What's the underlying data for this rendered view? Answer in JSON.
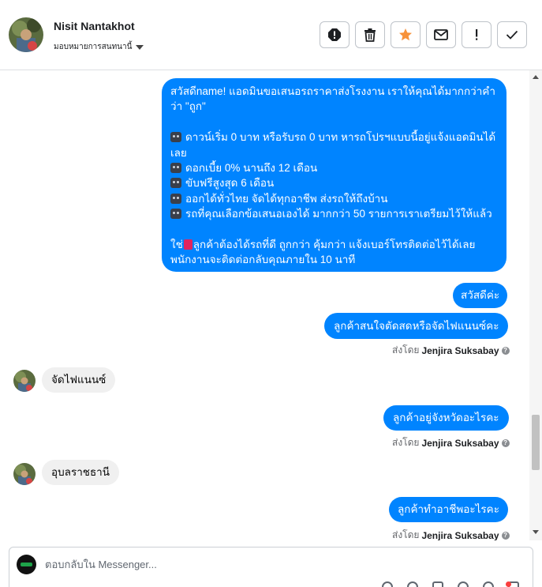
{
  "header": {
    "contact_name": "Nisit Nantakhot",
    "assign_label": "มอบหมายการสนทนานี้",
    "actions": [
      {
        "name": "spam-button",
        "icon": "alert-octagon-icon"
      },
      {
        "name": "delete-button",
        "icon": "trash-icon"
      },
      {
        "name": "star-button",
        "icon": "star-icon"
      },
      {
        "name": "mark-unread-button",
        "icon": "envelope-icon"
      },
      {
        "name": "follow-up-button",
        "icon": "exclamation-icon"
      },
      {
        "name": "mark-done-button",
        "icon": "check-icon"
      }
    ]
  },
  "thread": {
    "big_message": {
      "line1": "สวัสดีname! แอดมินขอเสนอรถราคาส่งโรงงาน เราให้คุณได้มากกว่าคำ",
      "line2": "ว่า \"ถูก\"",
      "line3": "ดาวน์เริ่ม 0 บาท หรือรับรถ 0 บาท หารถโปรฯแบบนี้อยู่แจ้งแอดมินได้",
      "line4": "เลย",
      "line5": "ดอกเบี้ย 0% นานถึง 12 เดือน",
      "line6": "ขับฟรีสูงสุด 6 เดือน",
      "line7": "ออกได้ทั่วไทย จัดได้ทุกอาชีพ ส่งรถให้ถึงบ้าน",
      "line8": "รถที่คุณเลือกข้อเสนอเองได้ มากกว่า 50 รายการเราเตรียมไว้ให้แล้ว",
      "line9a": "ใช่",
      "line9b": "ลูกค้าต้องได้รถที่ดี ถูกกว่า คุ้มกว่า แจ้งเบอร์โทรติดต่อไว้ได้เลย",
      "line10": "พนักงานจะติดต่อกลับคุณภายใน 10 นาที"
    },
    "msg_greeting": "สวัสดีค่ะ",
    "msg_q1": "ลูกค้าสนใจตัดสดหรือจัดไฟแนนซ์คะ",
    "sent_by_prefix": "ส่งโดย",
    "agent_name": "Jenjira Suksabay",
    "help_glyph": "?",
    "reply1": "จัดไฟแนนซ์",
    "msg_q2": "ลูกค้าอยู่จังหวัดอะไรคะ",
    "reply2": "อุบลราชธานี",
    "msg_q3": "ลูกค้าทำอาชีพอะไรคะ"
  },
  "composer": {
    "placeholder": "ตอบกลับใน Messenger..."
  },
  "colors": {
    "outgoing_bubble": "#0084ff",
    "incoming_bubble": "#f0f0f0",
    "star": "#f7923a",
    "badge": "#fa3e3e"
  }
}
